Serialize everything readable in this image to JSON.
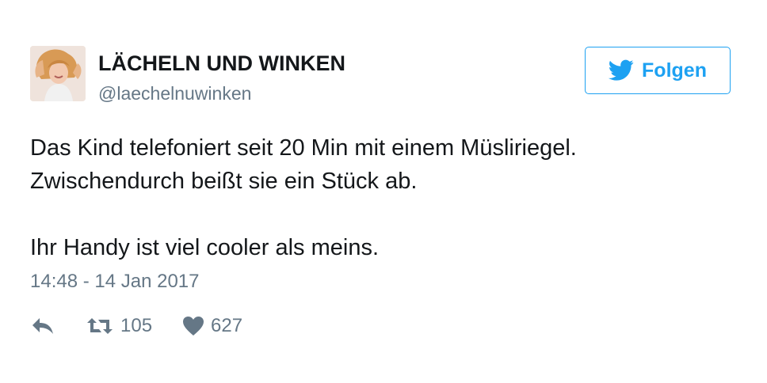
{
  "author": {
    "display_name": "LÄCHELN UND WINKEN",
    "handle": "@laechelnuwinken"
  },
  "follow_button": {
    "label": "Folgen",
    "icon": "twitter-bird-icon"
  },
  "tweet": {
    "lines": [
      "Das Kind telefoniert seit 20 Min mit einem Müsliriegel.",
      "Zwischendurch beißt sie ein Stück ab.",
      "",
      "Ihr Handy ist viel cooler als meins."
    ],
    "timestamp": "14:48 - 14 Jan 2017"
  },
  "actions": {
    "reply_icon": "reply-icon",
    "retweet_icon": "retweet-icon",
    "retweet_count": "105",
    "like_icon": "heart-icon",
    "like_count": "627"
  },
  "colors": {
    "text": "#14171a",
    "muted": "#657786",
    "accent": "#1da1f2",
    "background": "#ffffff"
  }
}
